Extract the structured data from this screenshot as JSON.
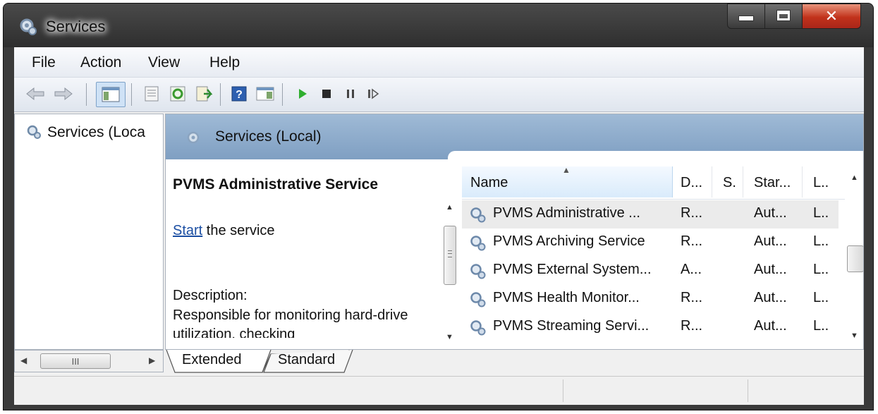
{
  "window": {
    "title": "Services"
  },
  "menu": [
    "File",
    "Action",
    "View",
    "Help"
  ],
  "toolbar": [
    "back-icon",
    "forward-icon",
    "show-hide-console-tree-icon",
    "properties-icon",
    "refresh-icon",
    "export-list-icon",
    "help-icon",
    "show-action-pane-icon",
    "start-service-icon",
    "stop-service-icon",
    "pause-service-icon",
    "resume-service-icon"
  ],
  "tree": {
    "root_label": "Services (Loca"
  },
  "right_header": {
    "title": "Services (Local)"
  },
  "details": {
    "service_name": "PVMS Administrative Service",
    "start_link": "Start",
    "start_suffix": " the service",
    "description_label": "Description:",
    "description_text": "Responsible for monitoring hard-drive utilization, checking"
  },
  "grid": {
    "headers": [
      "Name",
      "D...",
      "S.",
      "Star...",
      "L.."
    ],
    "rows": [
      {
        "name": "PVMS Administrative ...",
        "description": "R...",
        "status": "",
        "startup": "Aut...",
        "logon": "L.."
      },
      {
        "name": "PVMS Archiving Service",
        "description": "R...",
        "status": "",
        "startup": "Aut...",
        "logon": "L.."
      },
      {
        "name": "PVMS External System...",
        "description": "A...",
        "status": "",
        "startup": "Aut...",
        "logon": "L.."
      },
      {
        "name": "PVMS Health Monitor...",
        "description": "R...",
        "status": "",
        "startup": "Aut...",
        "logon": "L.."
      },
      {
        "name": "PVMS Streaming Servi...",
        "description": "R...",
        "status": "",
        "startup": "Aut...",
        "logon": "L.."
      }
    ]
  },
  "tabs": [
    "Extended",
    "Standard"
  ],
  "selected_tab": "Extended",
  "left_scroll_thumb": "III"
}
